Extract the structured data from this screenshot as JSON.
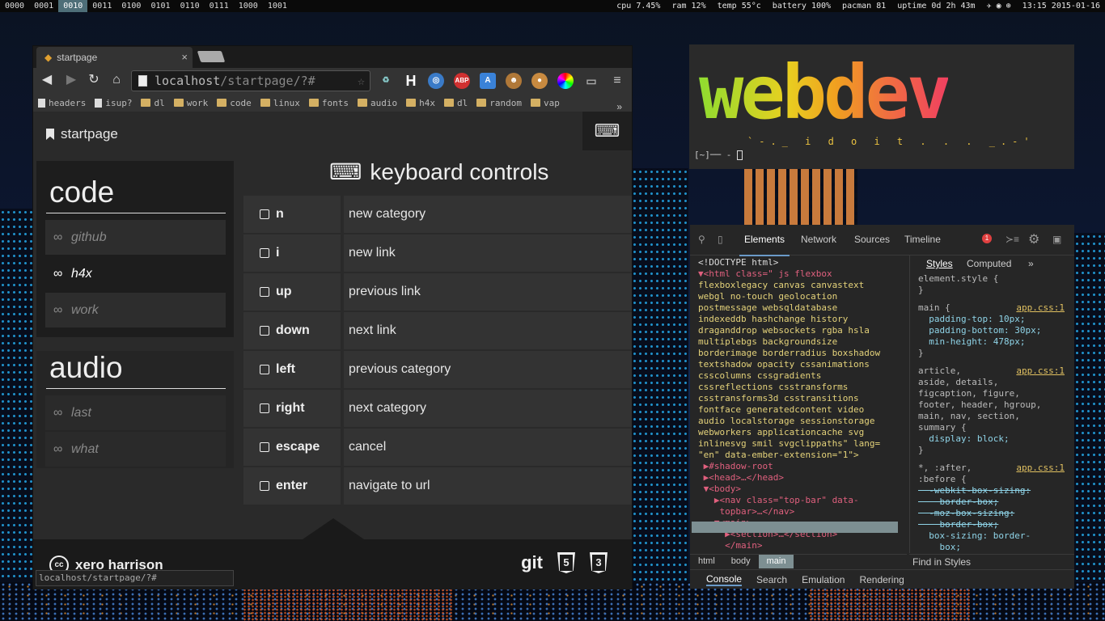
{
  "topbar": {
    "workspaces": [
      "0000",
      "0001",
      "0010",
      "0011",
      "0100",
      "0101",
      "0110",
      "0111",
      "1000",
      "1001"
    ],
    "active_workspace": "0010",
    "cpu": "cpu 7.45%",
    "ram": "ram 12%",
    "temp": "temp 55°c",
    "battery": "battery 100%",
    "pacman": "pacman 81",
    "uptime": "uptime 0d 2h 43m",
    "clock": "13:15 2015-01-16"
  },
  "browser": {
    "tab_title": "startpage",
    "tab_close": "×",
    "url_host": "localhost",
    "url_path": "/startpage/?#",
    "bookmarks": [
      "headers",
      "isup?",
      "dl",
      "work",
      "code",
      "linux",
      "fonts",
      "audio",
      "h4x",
      "dl",
      "random",
      "vap"
    ],
    "bookmark_types": [
      "page",
      "page",
      "folder",
      "folder",
      "folder",
      "folder",
      "folder",
      "folder",
      "folder",
      "folder",
      "folder",
      "folder"
    ],
    "bookmarks_more": "»",
    "status_url": "localhost/startpage/?#"
  },
  "page": {
    "title": "startpage",
    "categories": [
      {
        "name": "code",
        "links": [
          "github",
          "h4x",
          "work"
        ]
      },
      {
        "name": "audio",
        "links": [
          "last",
          "what"
        ]
      }
    ],
    "active_link": "h4x",
    "controls_title": "keyboard controls",
    "controls": [
      {
        "key": "n",
        "desc": "new category"
      },
      {
        "key": "i",
        "desc": "new link"
      },
      {
        "key": "up",
        "desc": "previous link"
      },
      {
        "key": "down",
        "desc": "next link"
      },
      {
        "key": "left",
        "desc": "previous category"
      },
      {
        "key": "right",
        "desc": "next category"
      },
      {
        "key": "escape",
        "desc": "cancel"
      },
      {
        "key": "enter",
        "desc": "navigate to url"
      }
    ],
    "author": "xero harrison",
    "cc": "cc",
    "footer_git": "git"
  },
  "terminal": {
    "banner": "webdev",
    "sub": "`-._ i d o i t . . . _.-'",
    "prompt": "[~]── -"
  },
  "devtools": {
    "tabs": [
      "Elements",
      "Network",
      "Sources",
      "Timeline"
    ],
    "active_tab": "Elements",
    "error_count": "1",
    "html_lines": [
      "<!DOCTYPE html>",
      "▼<html class=\" js flexbox",
      "flexboxlegacy canvas canvastext",
      "webgl no-touch geolocation",
      "postmessage websqldatabase",
      "indexeddb hashchange history",
      "draganddrop websockets rgba hsla",
      "multiplebgs backgroundsize",
      "borderimage borderradius boxshadow",
      "textshadow opacity cssanimations",
      "csscolumns cssgradients",
      "cssreflections csstransforms",
      "csstransforms3d csstransitions",
      "fontface generatedcontent video",
      "audio localstorage sessionstorage",
      "webworkers applicationcache svg",
      "inlinesvg smil svgclippaths\" lang=",
      "\"en\" data-ember-extension=\"1\">",
      " ▶#shadow-root",
      " ▶<head>…</head>",
      " ▼<body>",
      "   ▶<nav class=\"top-bar\" data-",
      "    topbar>…</nav>",
      "   ▼<main>",
      "     ▶<section>…</section>",
      "     </main>"
    ],
    "style_tabs": [
      "Styles",
      "Computed",
      "»"
    ],
    "styles": [
      {
        "text": "element.style {",
        "src": ""
      },
      {
        "text": "}",
        "src": ""
      },
      {
        "text": "main {",
        "src": "app.css:1"
      },
      {
        "text": "  padding-top: 10px;",
        "src": ""
      },
      {
        "text": "  padding-bottom: 30px;",
        "src": ""
      },
      {
        "text": "  min-height: 478px;",
        "src": ""
      },
      {
        "text": "}",
        "src": ""
      },
      {
        "text": "article,",
        "src": "app.css:1"
      },
      {
        "text": "aside, details,",
        "src": ""
      },
      {
        "text": "figcaption, figure,",
        "src": ""
      },
      {
        "text": "footer, header, hgroup,",
        "src": ""
      },
      {
        "text": "main, nav, section,",
        "src": ""
      },
      {
        "text": "summary {",
        "src": ""
      },
      {
        "text": "  display: block;",
        "src": ""
      },
      {
        "text": "}",
        "src": ""
      },
      {
        "text": "*, :after,",
        "src": "app.css:1"
      },
      {
        "text": ":before {",
        "src": ""
      },
      {
        "text": "  -webkit-box-sizing:",
        "src": ""
      },
      {
        "text": "    border-box;",
        "src": ""
      },
      {
        "text": "  -moz-box-sizing:",
        "src": ""
      },
      {
        "text": "    border-box;",
        "src": ""
      },
      {
        "text": "  box-sizing: border-",
        "src": ""
      },
      {
        "text": "    box;",
        "src": ""
      }
    ],
    "crumbs": [
      "html",
      "body",
      "main"
    ],
    "active_crumb": "main",
    "find_styles": "Find in Styles",
    "drawer_tabs": [
      "Console",
      "Search",
      "Emulation",
      "Rendering"
    ],
    "active_drawer": "Console"
  }
}
